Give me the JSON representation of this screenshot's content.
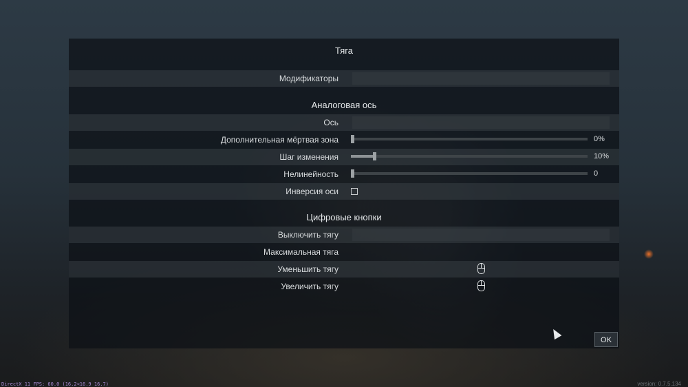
{
  "panel": {
    "title": "Тяга"
  },
  "modifiers": {
    "label": "Модификаторы"
  },
  "analog": {
    "heading": "Аналоговая ось",
    "axis_label": "Ось",
    "deadzone": {
      "label": "Дополнительная мёртвая зона",
      "value": "0%",
      "level": 0.0
    },
    "step": {
      "label": "Шаг изменения",
      "value": "10%",
      "level": 0.1
    },
    "nonlinearity": {
      "label": "Нелинейность",
      "value": "0",
      "level": 0.0
    },
    "invert": {
      "label": "Инверсия оси",
      "checked": false
    }
  },
  "digital": {
    "heading": "Цифровые кнопки",
    "items": [
      {
        "label": "Выключить тягу",
        "binding": ""
      },
      {
        "label": "Максимальная тяга",
        "binding": ""
      },
      {
        "label": "Уменьшить тягу",
        "binding_icon": "mouse-icon"
      },
      {
        "label": "Увеличить тягу",
        "binding_icon": "mouse-icon"
      }
    ]
  },
  "buttons": {
    "ok_label": "OK"
  },
  "footer": {
    "left": "DirectX 11  FPS: 60.0 (16.2<16.9 16.7)",
    "right": "version: 0.7.5.134"
  },
  "colors": {
    "panel_bg": "#0c1116",
    "row_alt": "#464e54",
    "slider_fill": "#8e9396",
    "footer_left": "#a98cd6"
  }
}
